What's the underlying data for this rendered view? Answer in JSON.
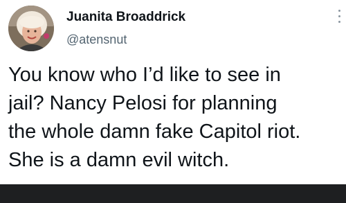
{
  "author": {
    "display_name": "Juanita Broaddrick",
    "handle": "@atensnut",
    "avatar_icon": "user-avatar-photo"
  },
  "tweet": {
    "lines": [
      "You know who I’d like to see in",
      "jail?  Nancy Pelosi for planning",
      "the whole damn fake Capitol riot.",
      "She is a damn evil witch."
    ]
  },
  "menu": {
    "icon": "more-options-icon"
  },
  "colors": {
    "text_primary": "#0f1419",
    "text_secondary": "#536471",
    "bottom_bar": "#1e1f21"
  }
}
